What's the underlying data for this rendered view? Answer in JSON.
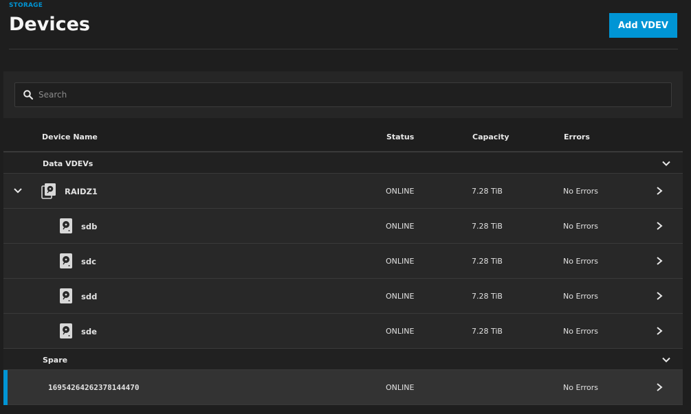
{
  "header": {
    "breadcrumb": "STORAGE",
    "title": "Devices",
    "add_button": "Add VDEV"
  },
  "search": {
    "placeholder": "Search",
    "value": ""
  },
  "columns": {
    "name": "Device Name",
    "status": "Status",
    "capacity": "Capacity",
    "errors": "Errors"
  },
  "groups": {
    "data": "Data VDEVs",
    "spare": "Spare"
  },
  "vdev": {
    "name": "RAIDZ1",
    "status": "ONLINE",
    "capacity": "7.28 TiB",
    "errors": "No Errors"
  },
  "disks": [
    {
      "name": "sdb",
      "status": "ONLINE",
      "capacity": "7.28 TiB",
      "errors": "No Errors"
    },
    {
      "name": "sdc",
      "status": "ONLINE",
      "capacity": "7.28 TiB",
      "errors": "No Errors"
    },
    {
      "name": "sdd",
      "status": "ONLINE",
      "capacity": "7.28 TiB",
      "errors": "No Errors"
    },
    {
      "name": "sde",
      "status": "ONLINE",
      "capacity": "7.28 TiB",
      "errors": "No Errors"
    }
  ],
  "spare": {
    "name": "16954264262378144470",
    "status": "ONLINE",
    "capacity": "",
    "errors": "No Errors"
  },
  "icons": {
    "search": "search-icon",
    "chevron_down": "chevron-down-icon",
    "chevron_right": "chevron-right-icon",
    "disk": "hard-disk-icon",
    "vdev": "vdev-stack-icon"
  },
  "colors": {
    "accent": "#0095d5",
    "background": "#1e1e1e",
    "panel": "#282828"
  }
}
